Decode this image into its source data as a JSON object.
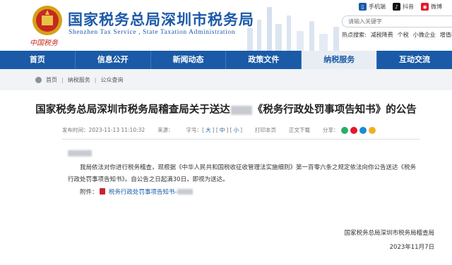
{
  "header": {
    "site_title": "国家税务总局深圳市税务局",
    "site_subtitle": "Shenzhen Tax Service , State Taxation Administration",
    "slogan": "中国税务",
    "social": [
      {
        "label": "手机端",
        "icon": "mobile-icon",
        "color": "#1a5aa6"
      },
      {
        "label": "抖音",
        "icon": "douyin-icon",
        "color": "#111111"
      },
      {
        "label": "微博",
        "icon": "weibo-icon",
        "color": "#e6162d"
      }
    ],
    "search_placeholder": "请输入关键字",
    "hot_search_label": "热点搜索:",
    "hot_search": [
      "减税降费",
      "个税",
      "小微企业",
      "增值税"
    ]
  },
  "nav": [
    {
      "label": "首页",
      "active": false
    },
    {
      "label": "信息公开",
      "active": false
    },
    {
      "label": "新闻动态",
      "active": false
    },
    {
      "label": "政策文件",
      "active": false
    },
    {
      "label": "纳税服务",
      "active": true
    },
    {
      "label": "互动交流",
      "active": false
    }
  ],
  "breadcrumb": [
    "首页",
    "纳税服务",
    "公众查询"
  ],
  "article": {
    "title_before": "国家税务总局深圳市税务局稽查局关于送达",
    "title_after": "《税务行政处罚事项告知书》的公告",
    "publish_label": "发布时间：",
    "publish_time": "2023-11-13 11:10:32",
    "source_label": "来源：",
    "font_label": "字号：",
    "size_big": "大",
    "size_mid": "中",
    "size_small": "小",
    "print_label": "打印本页",
    "text_version_label": "正文下载",
    "share_label": "分享：",
    "body": "我局依法对你进行税务稽查，现根据《中华人民共和国税收征收管理法实施细则》第一百零六条之规定依法向你公告送达《税务行政处罚事项告知书》。自公告之日起满30日，即视为送达。",
    "attachment_label": "附件：",
    "attachment_name": "税务行政处罚事项告知书-",
    "signature_org": "国家税务总局深圳市税务局稽查局",
    "signature_date": "2023年11月7日"
  },
  "colors": {
    "brand_blue": "#1a5aa6",
    "red": "#c8281e"
  }
}
